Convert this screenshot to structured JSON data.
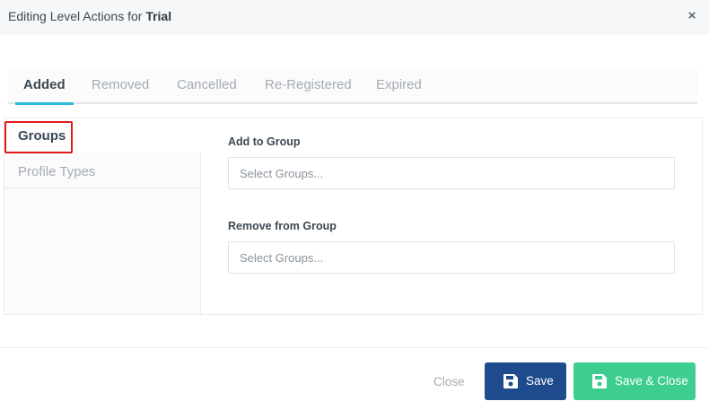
{
  "modal": {
    "title_prefix": "Editing Level Actions for ",
    "title_level": "Trial",
    "close_icon": "×"
  },
  "tabs": [
    {
      "label": "Added",
      "active": true
    },
    {
      "label": "Removed",
      "active": false
    },
    {
      "label": "Cancelled",
      "active": false
    },
    {
      "label": "Re-Registered",
      "active": false
    },
    {
      "label": "Expired",
      "active": false
    }
  ],
  "sidebar": {
    "items": [
      {
        "label": "Groups",
        "active": true
      },
      {
        "label": "Profile Types",
        "active": false
      }
    ]
  },
  "form": {
    "add_label": "Add to Group",
    "add_placeholder": "Select Groups...",
    "remove_label": "Remove from Group",
    "remove_placeholder": "Select Groups..."
  },
  "footer": {
    "close_label": "Close",
    "save_label": "Save",
    "save_close_label": "Save & Close",
    "save_icon": "floppy-disk-icon"
  },
  "colors": {
    "tab_active_underline": "#2fb8d6",
    "highlight_box": "#e11a1a",
    "save_button": "#1e4b8d",
    "save_close_button": "#3dcd8e"
  }
}
